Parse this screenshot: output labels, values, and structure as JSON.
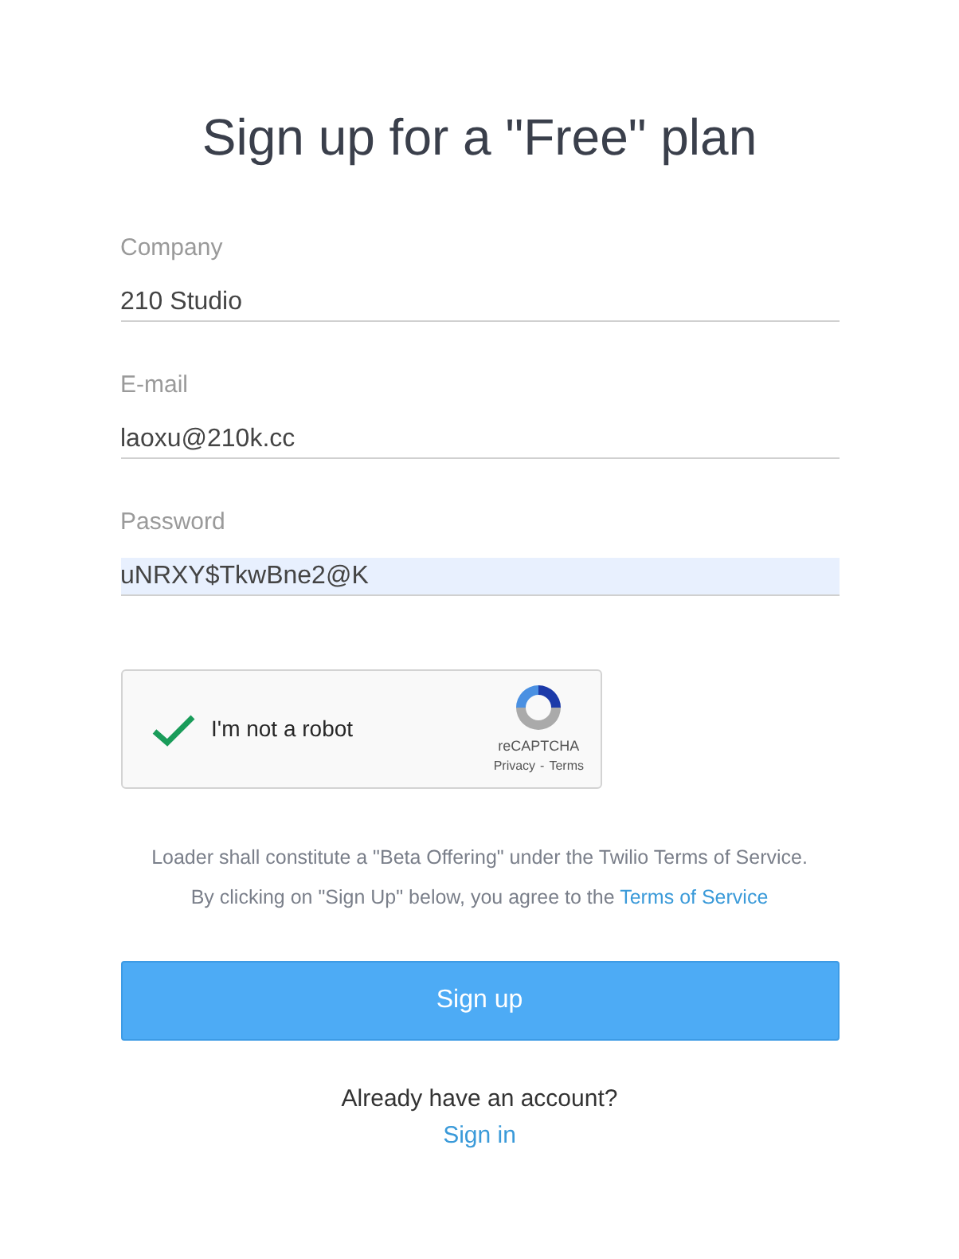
{
  "title": "Sign up for a \"Free\" plan",
  "fields": [
    {
      "label": "Company",
      "value": "210 Studio",
      "autofilled": false
    },
    {
      "label": "E-mail",
      "value": "laoxu@210k.cc",
      "autofilled": false
    },
    {
      "label": "Password",
      "value": "uNRXY$TkwBne2@K",
      "autofilled": true
    }
  ],
  "captcha": {
    "label": "I'm not a robot",
    "checked": true,
    "brand": "reCAPTCHA",
    "privacy": "Privacy",
    "separator": "-",
    "terms": "Terms"
  },
  "notice": "Loader shall constitute a \"Beta Offering\" under the Twilio Terms of Service.",
  "agreement": {
    "text": "By clicking on \"Sign Up\" below, you agree to the",
    "link": "Terms of Service"
  },
  "submit": "Sign up",
  "account_prompt": "Already have an account?",
  "sign_in": "Sign in"
}
